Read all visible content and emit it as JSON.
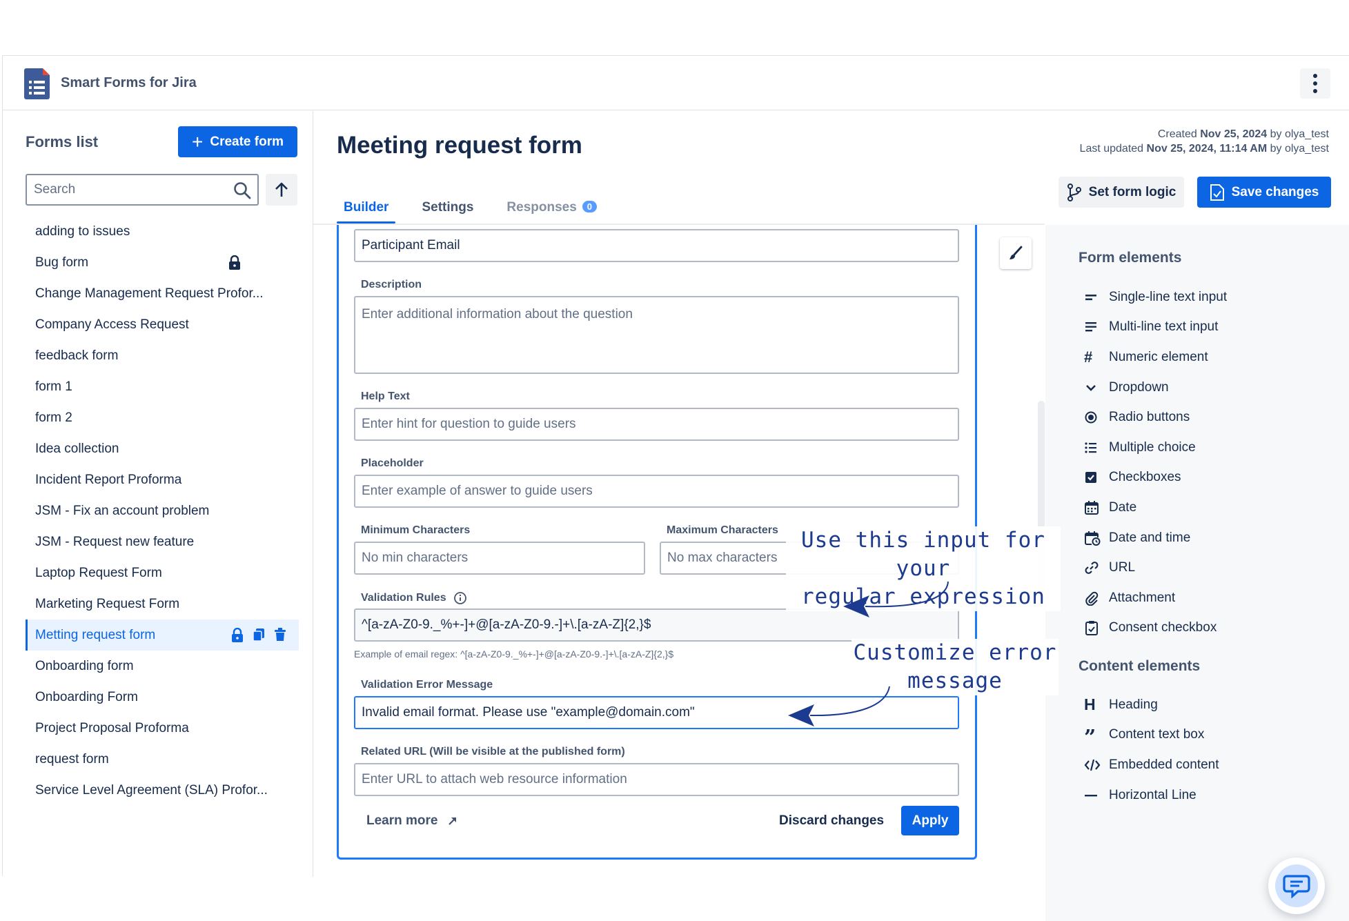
{
  "app": {
    "title": "Smart Forms for Jira"
  },
  "sidebar": {
    "title": "Forms list",
    "create_label": "Create form",
    "search_placeholder": "Search",
    "forms": [
      "adding to issues",
      "Bug form",
      "Change Management Request Profor...",
      "Company Access Request",
      "feedback form",
      "form 1",
      "form 2",
      "Idea collection",
      "Incident Report Proforma",
      "JSM - Fix an account problem",
      "JSM - Request new feature",
      "Laptop Request Form",
      "Marketing Request Form",
      "Metting request form",
      "Onboarding form",
      "Onboarding Form",
      "Project Proposal Proforma",
      "request form",
      "Service Level Agreement (SLA) Profor..."
    ],
    "active_form": "Metting request form"
  },
  "header": {
    "title": "Meeting request form",
    "created_prefix": "Created",
    "created_date": "Nov 25, 2024",
    "created_by": "by olya_test",
    "updated_prefix": "Last updated",
    "updated_date": "Nov 25, 2024, 11:14 AM",
    "updated_by": "by olya_test",
    "logic_label": "Set form logic",
    "save_label": "Save changes"
  },
  "tabs": [
    {
      "label": "Builder"
    },
    {
      "label": "Settings"
    },
    {
      "label": "Responses",
      "badge": "0"
    }
  ],
  "editor": {
    "question_value": "Participant Email",
    "description_label": "Description",
    "description_placeholder": "Enter additional information about the question",
    "help_label": "Help Text",
    "help_placeholder": "Enter hint for question to guide users",
    "placeholder_label": "Placeholder",
    "placeholder_placeholder": "Enter example of answer to guide users",
    "min_label": "Minimum Characters",
    "min_placeholder": "No min characters",
    "max_label": "Maximum Characters",
    "max_placeholder": "No max characters",
    "validation_label": "Validation Rules",
    "validation_value": "^[a-zA-Z0-9._%+-]+@[a-zA-Z0-9.-]+\\.[a-zA-Z]{2,}$",
    "validation_hint": "Example of email regex: ^[a-zA-Z0-9._%+-]+@[a-zA-Z0-9.-]+\\.[a-zA-Z]{2,}$",
    "error_label": "Validation Error Message",
    "error_value": "Invalid email format. Please use \"example@domain.com\"",
    "url_label": "Related URL (Will be visible at the published form)",
    "url_placeholder": "Enter URL to attach web resource information",
    "learn_more": "Learn more",
    "discard_label": "Discard changes",
    "apply_label": "Apply"
  },
  "form_elements": {
    "title": "Form elements",
    "items": [
      {
        "label": "Single-line text input",
        "icon": "single-line-icon"
      },
      {
        "label": "Multi-line text input",
        "icon": "multi-line-icon"
      },
      {
        "label": "Numeric element",
        "icon": "hash-icon"
      },
      {
        "label": "Dropdown",
        "icon": "chevron-down-icon"
      },
      {
        "label": "Radio buttons",
        "icon": "radio-icon"
      },
      {
        "label": "Multiple choice",
        "icon": "list-icon"
      },
      {
        "label": "Checkboxes",
        "icon": "checkbox-icon"
      },
      {
        "label": "Date",
        "icon": "calendar-icon"
      },
      {
        "label": "Date and time",
        "icon": "calendar-clock-icon"
      },
      {
        "label": "URL",
        "icon": "link-icon"
      },
      {
        "label": "Attachment",
        "icon": "paperclip-icon"
      },
      {
        "label": "Consent checkbox",
        "icon": "clipboard-check-icon"
      }
    ]
  },
  "content_elements": {
    "title": "Content elements",
    "items": [
      {
        "label": "Heading",
        "icon": "heading-icon"
      },
      {
        "label": "Content text box",
        "icon": "quote-icon"
      },
      {
        "label": "Embedded content",
        "icon": "code-icon"
      },
      {
        "label": "Horizontal Line",
        "icon": "horizontal-line-icon"
      }
    ]
  },
  "annotations": {
    "regex_note_line1": "Use this input for your",
    "regex_note_line2": "regular expression",
    "error_note_line1": "Customize error",
    "error_note_line2": "message"
  },
  "colors": {
    "primary": "#0c66e4",
    "focus": "#1d7afc",
    "annotation": "#1c3a8f",
    "text": "#172b4d"
  }
}
